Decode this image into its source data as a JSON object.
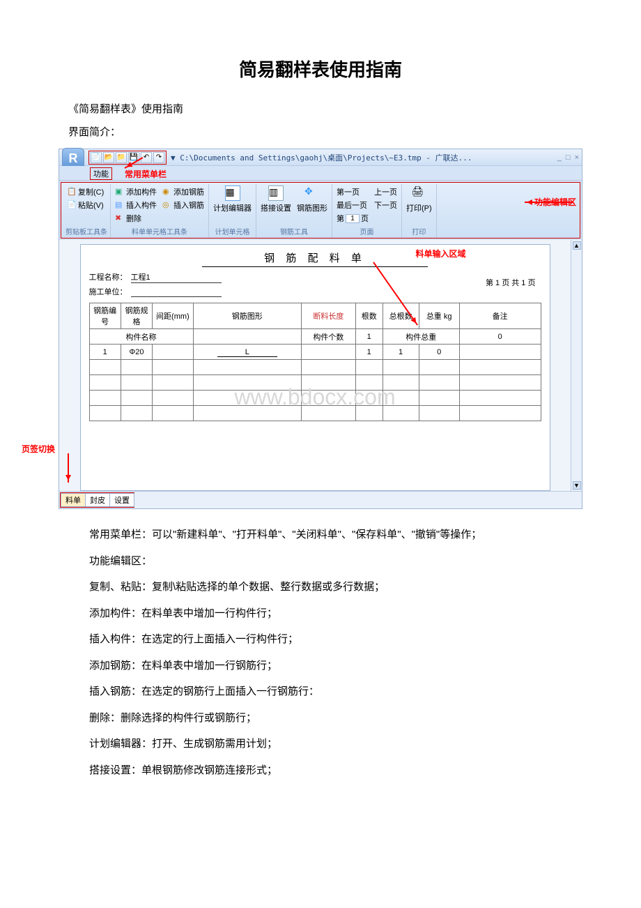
{
  "doc": {
    "title": "简易翻样表使用指南",
    "subtitle": "《简易翻样表》使用指南",
    "intro": "界面简介："
  },
  "app": {
    "titlepath": "▼ C:\\Documents and Settings\\gaohj\\桌面\\Projects\\~E3.tmp - 广联达...",
    "logo": "R",
    "func_tab": "功能",
    "hint_common_menu": "常用菜单栏",
    "hint_func_area": "功能编辑区",
    "hint_input_area": "料单输入区域",
    "hint_tab_switch": "页签切换"
  },
  "ribbon": {
    "clipboard": {
      "copy": "复制(C)",
      "paste": "粘贴(V)",
      "group": "剪贴板工具条"
    },
    "cell": {
      "add_member": "添加构件",
      "insert_member": "插入构件",
      "delete": "删除",
      "add_rebar": "添加钢筋",
      "insert_rebar": "插入钢筋",
      "group": "料单单元格工具条"
    },
    "plan": {
      "label": "计划编辑器",
      "group": "计划单元格"
    },
    "rebar": {
      "lap": "搭接设置",
      "shape": "钢筋图形",
      "group": "钢筋工具"
    },
    "page": {
      "first": "第一页",
      "last": "最后一页",
      "prev": "上一页",
      "next": "下一页",
      "num_label": "第",
      "num": "1",
      "num_suffix": "页",
      "group": "页面"
    },
    "print": {
      "label": "打印(P)",
      "group": "打印"
    }
  },
  "sheet": {
    "title": "钢  筋  配  料  单",
    "proj_label": "工程名称：",
    "proj_val": "工程1",
    "unit_label": "施工单位：",
    "page_ind": "第 1 页 共 1 页",
    "headers": [
      "钢筋编号",
      "钢筋规格",
      "间距(mm)",
      "钢筋图形",
      "断料长度",
      "根数",
      "总根数",
      "总重 kg",
      "备注"
    ],
    "row2": {
      "member_name": "构件名称",
      "member_count": "构件个数",
      "c1": "1",
      "member_weight": "构件总重",
      "c0": "0"
    },
    "row3": {
      "n": "1",
      "spec": "Φ20",
      "shape": "L",
      "r1": "1",
      "r2": "1",
      "r3": "0"
    }
  },
  "tabs": {
    "t1": "料单",
    "t2": "封皮",
    "t3": "设置"
  },
  "watermark": "www.bdocx.com",
  "body": {
    "p1": "常用菜单栏：可以\"新建料单\"、\"打开料单\"、\"关闭料单\"、\"保存料单\"、\"撤销\"等操作；",
    "p2": "功能编辑区：",
    "p3": "复制、粘贴：复制\\粘贴选择的单个数据、整行数据或多行数据；",
    "p4": "添加构件：在料单表中增加一行构件行；",
    "p5": "插入构件：在选定的行上面插入一行构件行；",
    "p6": "添加钢筋：在料单表中增加一行钢筋行；",
    "p7": "插入钢筋：在选定的钢筋行上面插入一行钢筋行：",
    "p8": "删除：删除选择的构件行或钢筋行；",
    "p9": "计划编辑器：打开、生成钢筋需用计划；",
    "p10": "搭接设置：单根钢筋修改钢筋连接形式；"
  }
}
